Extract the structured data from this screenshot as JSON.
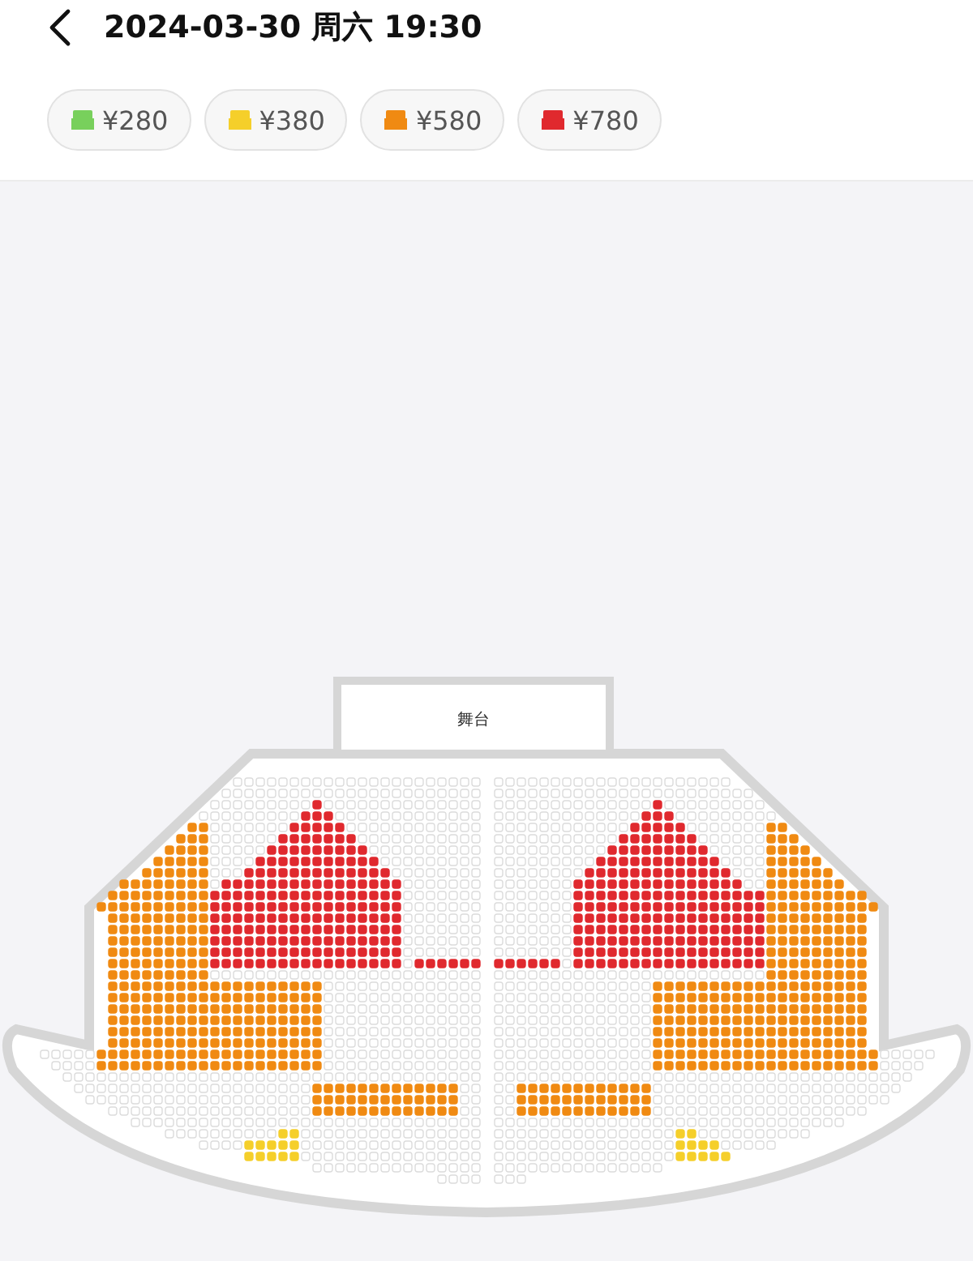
{
  "header": {
    "title": "2024-03-30  周六 19:30"
  },
  "price_tiers": [
    {
      "label": "¥280",
      "color": "#78d05c"
    },
    {
      "label": "¥380",
      "color": "#f5cf2a"
    },
    {
      "label": "¥580",
      "color": "#f08a12"
    },
    {
      "label": "¥780",
      "color": "#e0292e"
    }
  ],
  "stage": {
    "label": "舞台"
  }
}
